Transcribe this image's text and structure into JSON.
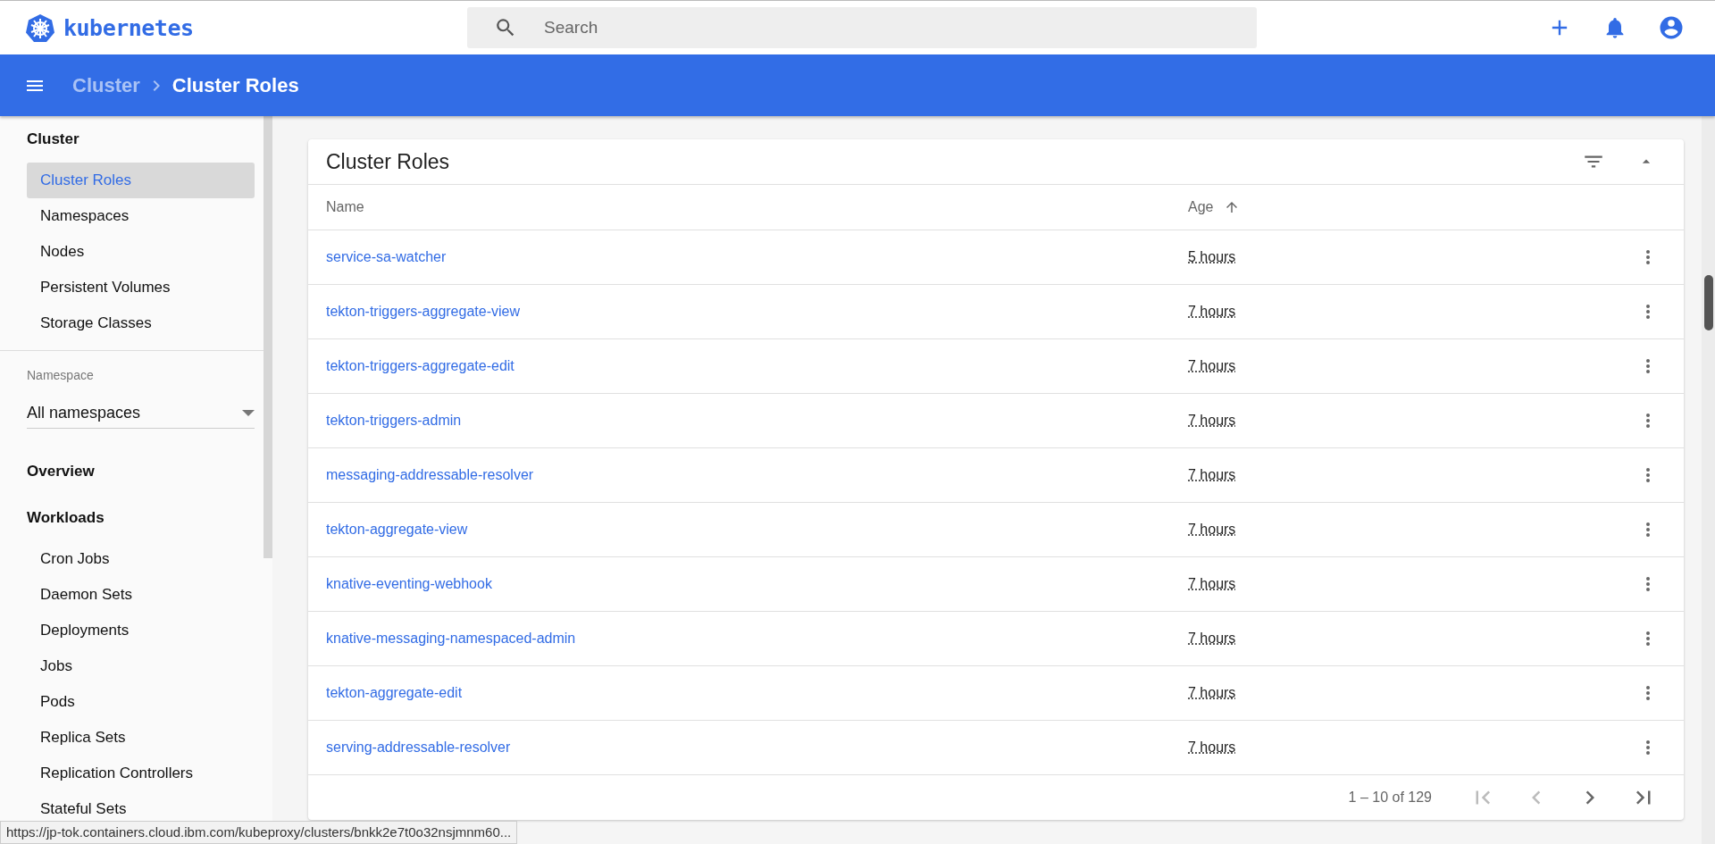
{
  "topbar": {
    "brand": "kubernetes",
    "search": {
      "placeholder": "Search"
    }
  },
  "toolbar": {
    "breadcrumbs": [
      {
        "label": "Cluster",
        "current": false
      },
      {
        "label": "Cluster Roles",
        "current": true
      }
    ]
  },
  "sidebar": {
    "sections": [
      {
        "title": "Cluster",
        "items": [
          {
            "label": "Cluster Roles",
            "selected": true
          },
          {
            "label": "Namespaces",
            "selected": false
          },
          {
            "label": "Nodes",
            "selected": false
          },
          {
            "label": "Persistent Volumes",
            "selected": false
          },
          {
            "label": "Storage Classes",
            "selected": false
          }
        ]
      },
      {
        "kind": "namespace",
        "label": "Namespace",
        "value": "All namespaces"
      },
      {
        "title": "Overview"
      },
      {
        "title": "Workloads",
        "items": [
          {
            "label": "Cron Jobs",
            "selected": false
          },
          {
            "label": "Daemon Sets",
            "selected": false
          },
          {
            "label": "Deployments",
            "selected": false
          },
          {
            "label": "Jobs",
            "selected": false
          },
          {
            "label": "Pods",
            "selected": false
          },
          {
            "label": "Replica Sets",
            "selected": false
          },
          {
            "label": "Replication Controllers",
            "selected": false
          },
          {
            "label": "Stateful Sets",
            "selected": false
          }
        ]
      }
    ]
  },
  "card": {
    "title": "Cluster Roles",
    "table": {
      "columns": [
        "Name",
        "Age"
      ],
      "rows": [
        {
          "name": "service-sa-watcher",
          "age": "5 hours"
        },
        {
          "name": "tekton-triggers-aggregate-view",
          "age": "7 hours"
        },
        {
          "name": "tekton-triggers-aggregate-edit",
          "age": "7 hours"
        },
        {
          "name": "tekton-triggers-admin",
          "age": "7 hours"
        },
        {
          "name": "messaging-addressable-resolver",
          "age": "7 hours"
        },
        {
          "name": "tekton-aggregate-view",
          "age": "7 hours"
        },
        {
          "name": "knative-eventing-webhook",
          "age": "7 hours"
        },
        {
          "name": "knative-messaging-namespaced-admin",
          "age": "7 hours"
        },
        {
          "name": "tekton-aggregate-edit",
          "age": "7 hours"
        },
        {
          "name": "serving-addressable-resolver",
          "age": "7 hours"
        }
      ]
    },
    "paginator": {
      "range": "1 – 10 of 129",
      "buttons": [
        {
          "kind": "first",
          "disabled": true
        },
        {
          "kind": "prev",
          "disabled": true
        },
        {
          "kind": "next",
          "disabled": false
        },
        {
          "kind": "last",
          "disabled": false
        }
      ]
    }
  },
  "status_url": "https://jp-tok.containers.cloud.ibm.com/kubeproxy/clusters/bnkk2e7t0o32nsjmnm60..."
}
